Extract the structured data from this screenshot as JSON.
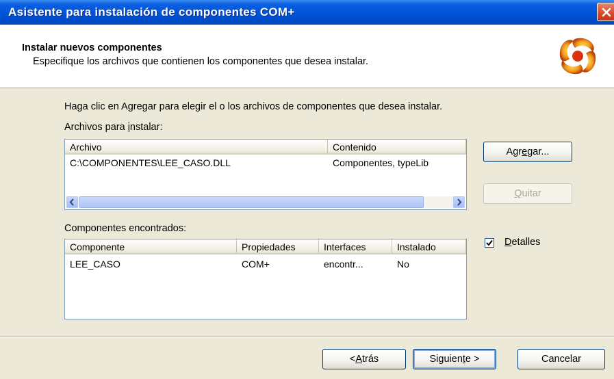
{
  "window": {
    "title": "Asistente para instalación de componentes COM+"
  },
  "header": {
    "title": "Instalar nuevos componentes",
    "subtitle": "Especifique los archivos que contienen los componentes que desea instalar."
  },
  "intro": "Haga clic en Agregar para elegir el o los archivos de componentes que desea instalar.",
  "files": {
    "label_pre": "Archivos para ",
    "label_u": "i",
    "label_post": "nstalar:",
    "columns": [
      "Archivo",
      "Contenido"
    ],
    "rows": [
      {
        "archivo": "C:\\COMPONENTES\\LEE_CASO.DLL",
        "contenido": "Componentes, typeLib"
      }
    ]
  },
  "buttons": {
    "agregar_pre": "Agr",
    "agregar_u": "e",
    "agregar_post": "gar...",
    "quitar_u": "Q",
    "quitar_post": "uitar",
    "atras_pre": "< ",
    "atras_u": "A",
    "atras_post": "trás",
    "siguiente_pre": "Siguien",
    "siguiente_u": "t",
    "siguiente_post": "e >",
    "cancelar": "Cancelar"
  },
  "components": {
    "label": "Componentes encontrados:",
    "columns": [
      "Componente",
      "Propiedades",
      "Interfaces",
      "Instalado"
    ],
    "rows": [
      {
        "componente": "LEE_CASO",
        "propiedades": "COM+",
        "interfaces": "encontr...",
        "instalado": "No"
      }
    ]
  },
  "detalles": {
    "label_u": "D",
    "label_post": "etalles",
    "checked": true
  },
  "colors": {
    "titlebar": "#0052d6",
    "dialog": "#ece9d8",
    "button_border": "#003c74"
  },
  "icons": [
    "close-icon",
    "wizard-logo-icon",
    "arrow-left-icon",
    "arrow-right-icon",
    "checkmark-icon"
  ]
}
